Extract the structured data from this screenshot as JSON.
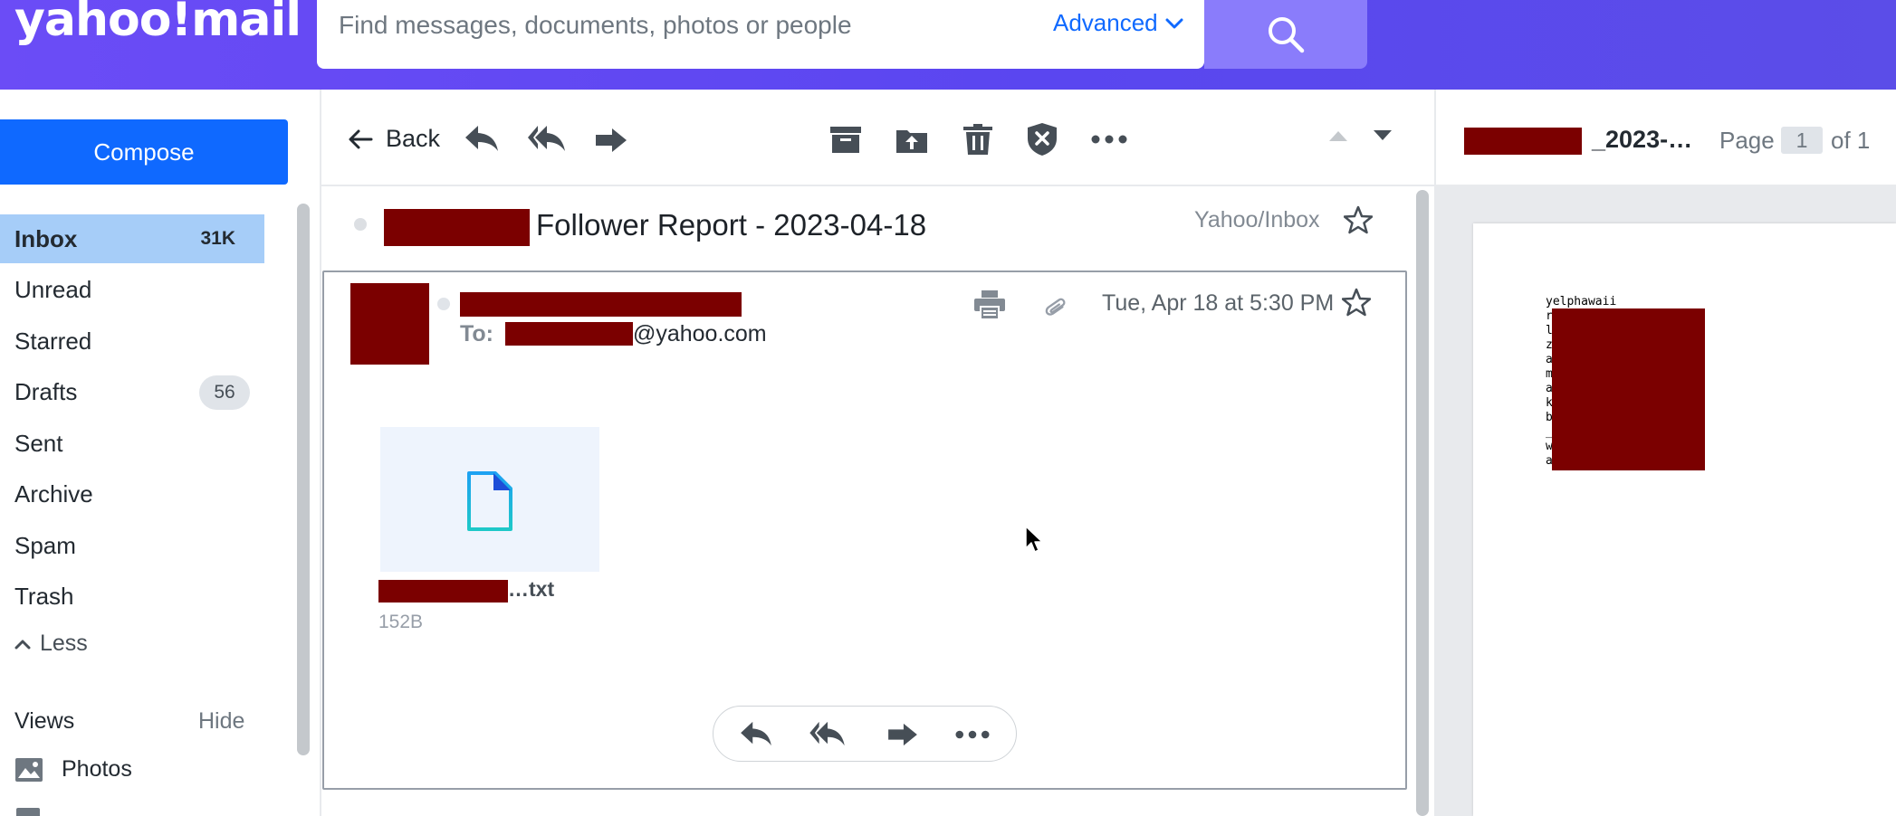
{
  "header": {
    "logo_text": "yahoo!mail",
    "search_placeholder": "Find messages, documents, photos or people",
    "advanced_label": "Advanced"
  },
  "sidebar": {
    "compose_label": "Compose",
    "items": [
      {
        "label": "Inbox",
        "count": "31K"
      },
      {
        "label": "Unread"
      },
      {
        "label": "Starred"
      },
      {
        "label": "Drafts",
        "count": "56"
      },
      {
        "label": "Sent"
      },
      {
        "label": "Archive"
      },
      {
        "label": "Spam"
      },
      {
        "label": "Trash"
      }
    ],
    "less_label": "Less",
    "views_label": "Views",
    "hide_label": "Hide",
    "photos_label": "Photos"
  },
  "toolbar": {
    "back_label": "Back"
  },
  "message": {
    "subject": "Follower Report - 2023-04-18",
    "folder_path": "Yahoo/Inbox",
    "to_label": "To:",
    "to_domain": "@yahoo.com",
    "date": "Tue, Apr 18 at 5:30 PM",
    "attachment": {
      "name_suffix": "…txt",
      "size": "152B"
    }
  },
  "preview": {
    "title_suffix": "_2023-…",
    "page_label": "Page",
    "page_current": "1",
    "page_total_label": "of 1",
    "doc_text_first_line": "yelphawaii",
    "doc_text_letters": [
      "r",
      "l",
      "z",
      "a",
      "m",
      "a",
      "k",
      "b",
      "_",
      "w",
      "a"
    ]
  },
  "colors": {
    "header_bg": "#6b4cf6",
    "accent_blue": "#0f69ff",
    "inbox_active": "#a6cdf8",
    "redaction": "#7b0000"
  }
}
